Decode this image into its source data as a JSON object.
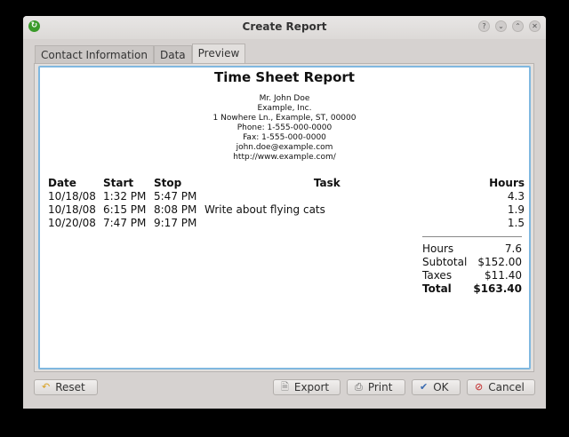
{
  "window": {
    "title": "Create Report"
  },
  "tabs": [
    {
      "label": "Contact Information"
    },
    {
      "label": "Data"
    },
    {
      "label": "Preview"
    }
  ],
  "report": {
    "title": "Time Sheet Report",
    "contact": [
      "Mr. John Doe",
      "Example, Inc.",
      "1 Nowhere Ln., Example, ST, 00000",
      "Phone: 1-555-000-0000",
      "Fax: 1-555-000-0000",
      "john.doe@example.com",
      "http://www.example.com/"
    ],
    "headers": {
      "date": "Date",
      "start": "Start",
      "stop": "Stop",
      "task": "Task",
      "hours": "Hours"
    },
    "rows": [
      {
        "date": "10/18/08",
        "start": "1:32 PM",
        "stop": "5:47 PM",
        "task": "",
        "hours": "4.3"
      },
      {
        "date": "10/18/08",
        "start": "6:15 PM",
        "stop": "8:08 PM",
        "task": "Write about flying cats",
        "hours": "1.9"
      },
      {
        "date": "10/20/08",
        "start": "7:47 PM",
        "stop": "9:17 PM",
        "task": "",
        "hours": "1.5"
      }
    ],
    "totals": {
      "hours_label": "Hours",
      "hours": "7.6",
      "subtotal_label": "Subtotal",
      "subtotal": "$152.00",
      "taxes_label": "Taxes",
      "taxes": "$11.40",
      "total_label": "Total",
      "total": "$163.40"
    }
  },
  "buttons": {
    "reset": "Reset",
    "export": "Export",
    "print": "Print",
    "ok": "OK",
    "cancel": "Cancel"
  }
}
